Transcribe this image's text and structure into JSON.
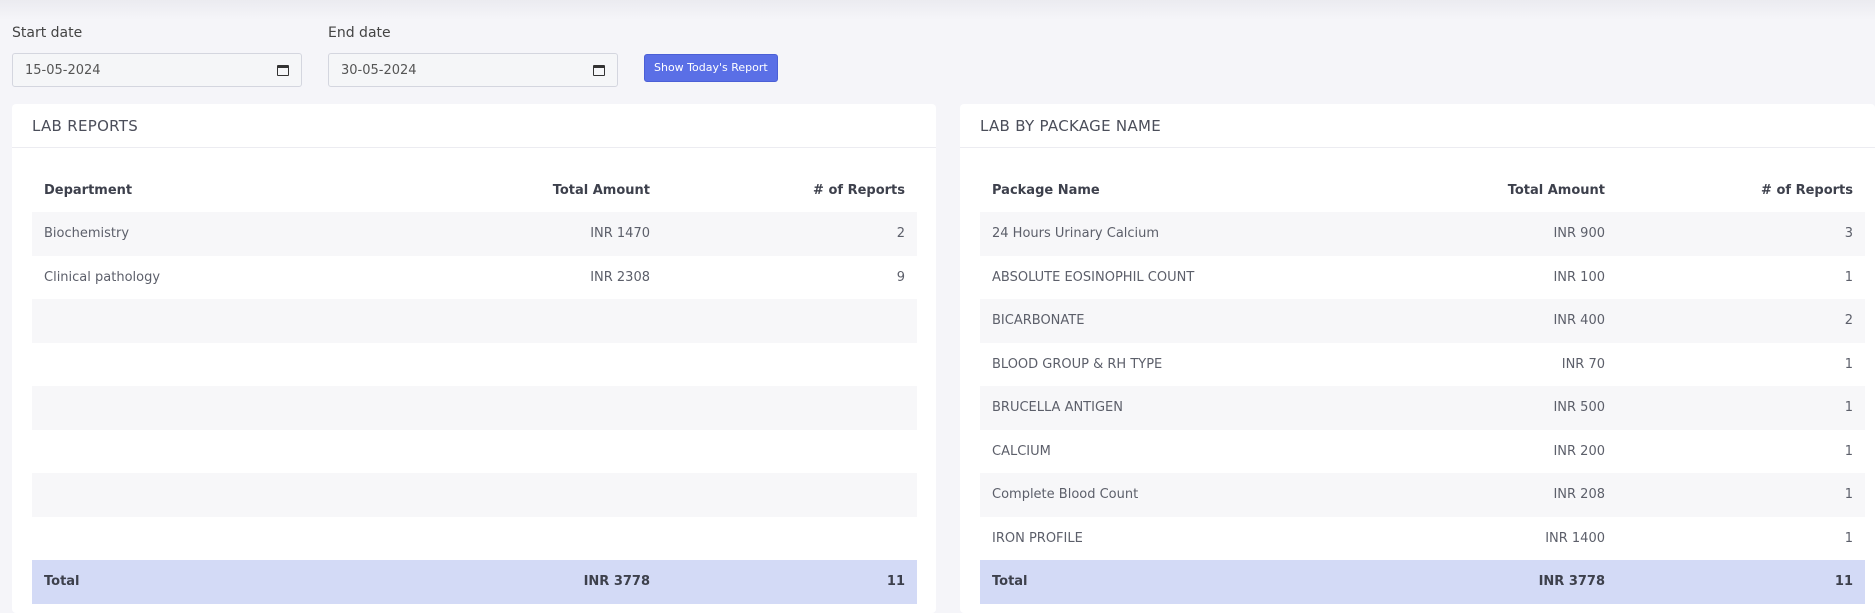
{
  "filters": {
    "start_label": "Start date",
    "start_value": "15-05-2024",
    "end_label": "End date",
    "end_value": "30-05-2024",
    "today_button": "Show Today's Report"
  },
  "lab_reports": {
    "title": "LAB REPORTS",
    "columns": [
      "Department",
      "Total Amount",
      "# of Reports"
    ],
    "rows": [
      [
        "Biochemistry",
        "INR 1470",
        "2"
      ],
      [
        "Clinical pathology",
        "INR 2308",
        "9"
      ],
      [
        "",
        "",
        ""
      ],
      [
        "",
        "",
        ""
      ],
      [
        "",
        "",
        ""
      ],
      [
        "",
        "",
        ""
      ],
      [
        "",
        "",
        ""
      ],
      [
        "",
        "",
        ""
      ]
    ],
    "total": [
      "Total",
      "INR 3778",
      "11"
    ]
  },
  "lab_by_package": {
    "title": "LAB BY PACKAGE NAME",
    "columns": [
      "Package Name",
      "Total Amount",
      "# of Reports"
    ],
    "rows": [
      [
        "24 Hours Urinary Calcium",
        "INR 900",
        "3"
      ],
      [
        "ABSOLUTE EOSINOPHIL COUNT",
        "INR 100",
        "1"
      ],
      [
        "BICARBONATE",
        "INR 400",
        "2"
      ],
      [
        "BLOOD GROUP & RH TYPE",
        "INR 70",
        "1"
      ],
      [
        "BRUCELLA ANTIGEN",
        "INR 500",
        "1"
      ],
      [
        "CALCIUM",
        "INR 200",
        "1"
      ],
      [
        "Complete Blood Count",
        "INR 208",
        "1"
      ],
      [
        "IRON PROFILE",
        "INR 1400",
        "1"
      ]
    ],
    "total": [
      "Total",
      "INR 3778",
      "11"
    ]
  }
}
